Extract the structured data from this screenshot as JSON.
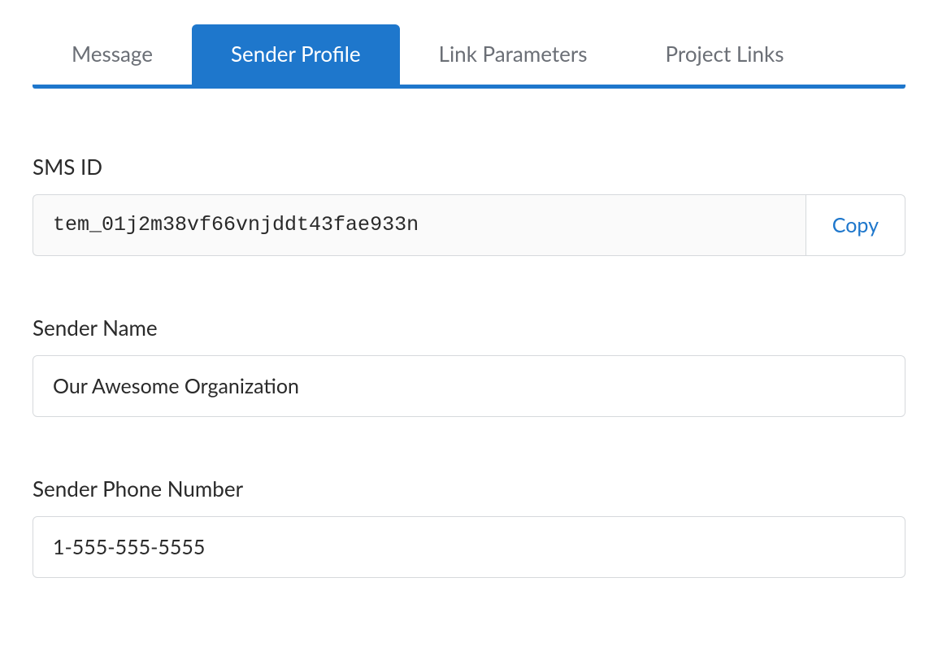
{
  "tabs": {
    "items": [
      {
        "label": "Message",
        "active": false
      },
      {
        "label": "Sender Profile",
        "active": true
      },
      {
        "label": "Link Parameters",
        "active": false
      },
      {
        "label": "Project Links",
        "active": false
      }
    ]
  },
  "fields": {
    "sms_id": {
      "label": "SMS ID",
      "value": "tem_01j2m38vf66vnjddt43fae933n",
      "copy_label": "Copy"
    },
    "sender_name": {
      "label": "Sender Name",
      "value": "Our Awesome Organization"
    },
    "sender_phone": {
      "label": "Sender Phone Number",
      "value": "1-555-555-5555"
    }
  }
}
